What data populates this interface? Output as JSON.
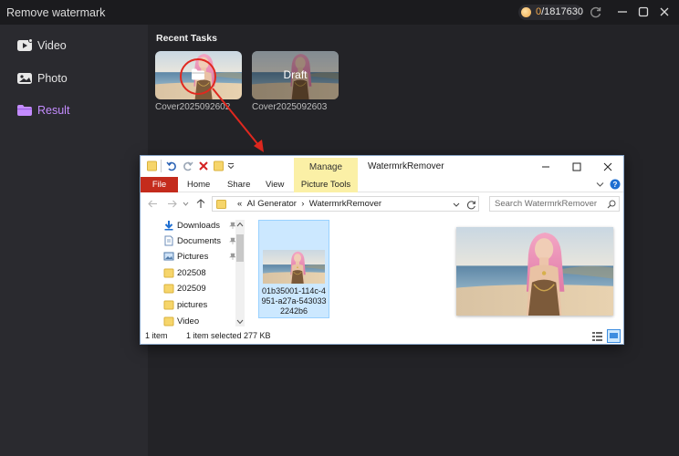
{
  "app": {
    "title": "Remove watermark",
    "credits_used": "0",
    "credits_total": "/1817630"
  },
  "sidebar": {
    "items": [
      {
        "label": "Video",
        "icon": "video-icon"
      },
      {
        "label": "Photo",
        "icon": "photo-icon"
      },
      {
        "label": "Result",
        "icon": "folder-icon",
        "active": true
      }
    ]
  },
  "main": {
    "section_title": "Recent Tasks",
    "tasks": [
      {
        "caption": "Cover2025092602",
        "overlay": "open-folder-icon"
      },
      {
        "caption": "Cover2025092603",
        "overlay_label": "Draft"
      }
    ]
  },
  "explorer": {
    "window_title": "WatermrkRemover",
    "manage_label": "Manage",
    "tabs": {
      "file": "File",
      "home": "Home",
      "share": "Share",
      "view": "View",
      "picture_tools": "Picture Tools"
    },
    "address": {
      "prefix": "«",
      "segments": [
        "AI Generator",
        "WatermrkRemover"
      ]
    },
    "search_placeholder": "Search WatermrkRemover",
    "nav_items": [
      {
        "label": "Downloads",
        "icon": "download-icon",
        "pinned": true
      },
      {
        "label": "Documents",
        "icon": "document-icon",
        "pinned": true
      },
      {
        "label": "Pictures",
        "icon": "pictures-icon",
        "pinned": true
      },
      {
        "label": "202508",
        "icon": "folder-icon"
      },
      {
        "label": "202509",
        "icon": "folder-icon"
      },
      {
        "label": "pictures",
        "icon": "folder-icon"
      },
      {
        "label": "Video",
        "icon": "folder-icon"
      }
    ],
    "file": {
      "name": "01b35001-114c-4951-a27a-5430332242b6"
    },
    "status": {
      "count": "1 item",
      "selected": "1 item selected",
      "size": "277 KB"
    }
  },
  "colors": {
    "accent_purple": "#c48cff",
    "annotation_red": "#e0281f",
    "credits_orange": "#f2a94f",
    "file_tab_red": "#c42b1c",
    "manage_yellow": "#fbf0a6"
  }
}
